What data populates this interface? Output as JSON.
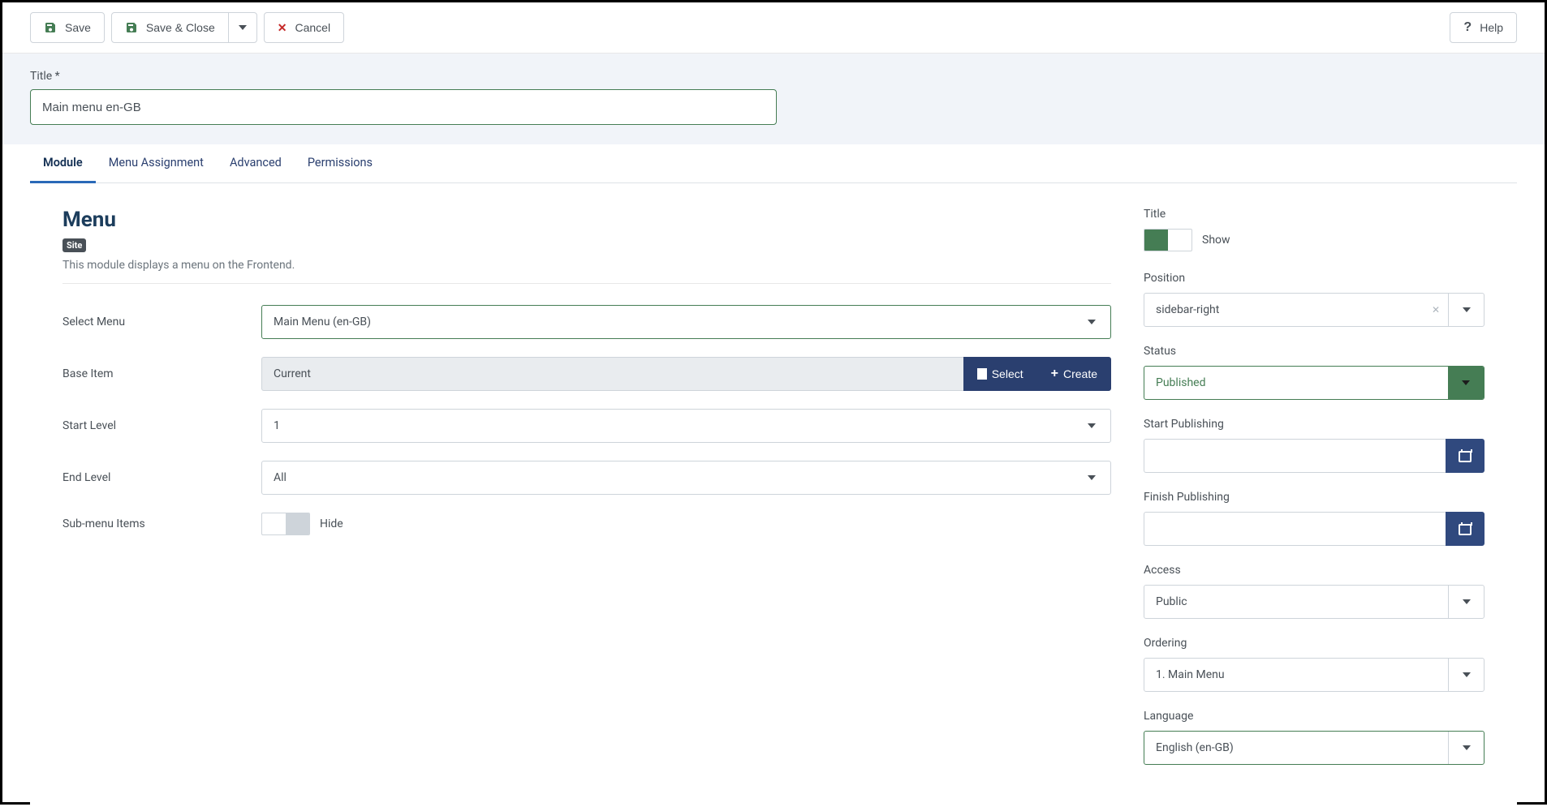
{
  "toolbar": {
    "save": "Save",
    "save_close": "Save & Close",
    "cancel": "Cancel",
    "help": "Help"
  },
  "header": {
    "title_label": "Title *",
    "title_value": "Main menu en-GB"
  },
  "tabs": [
    "Module",
    "Menu Assignment",
    "Advanced",
    "Permissions"
  ],
  "module": {
    "heading": "Menu",
    "badge": "Site",
    "description": "This module displays a menu on the Frontend.",
    "fields": {
      "select_menu": {
        "label": "Select Menu",
        "value": "Main Menu (en-GB)"
      },
      "base_item": {
        "label": "Base Item",
        "value": "Current",
        "select_btn": "Select",
        "create_btn": "Create"
      },
      "start_level": {
        "label": "Start Level",
        "value": "1"
      },
      "end_level": {
        "label": "End Level",
        "value": "All"
      },
      "submenu": {
        "label": "Sub-menu Items",
        "value": "Hide"
      }
    }
  },
  "sidebar": {
    "title": {
      "label": "Title",
      "value": "Show"
    },
    "position": {
      "label": "Position",
      "value": "sidebar-right"
    },
    "status": {
      "label": "Status",
      "value": "Published"
    },
    "start_publishing": {
      "label": "Start Publishing",
      "value": ""
    },
    "finish_publishing": {
      "label": "Finish Publishing",
      "value": ""
    },
    "access": {
      "label": "Access",
      "value": "Public"
    },
    "ordering": {
      "label": "Ordering",
      "value": "1. Main Menu"
    },
    "language": {
      "label": "Language",
      "value": "English (en-GB)"
    }
  }
}
